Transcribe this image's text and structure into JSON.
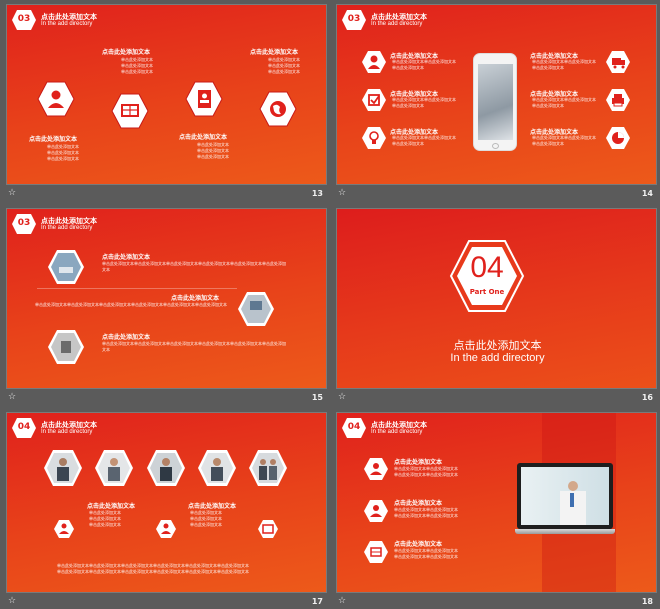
{
  "colors": {
    "accent": "#e0211c",
    "bg": "#5b5b5b",
    "white": "#ffffff"
  },
  "header": {
    "title": "点击此处添加文本",
    "subtitle": "In the add directory"
  },
  "filler": "单击此处添加文本",
  "filler_line": "单击此处添加文本单击此处添加文本",
  "filler_long": "单击此处添加文本单击此处添加文本单击此处添加文本单击此处添加文本单击此处添加文本单击此处添加文本",
  "star": "☆",
  "slides": [
    {
      "number": "13",
      "badge": "03",
      "items": [
        {
          "title": "点击此处添加文本",
          "icon": "user-icon"
        },
        {
          "title": "点击此处添加文本",
          "icon": "globe-network-icon"
        },
        {
          "title": "点击此处添加文本",
          "icon": "contact-book-icon"
        },
        {
          "title": "点击此处添加文本",
          "icon": "world-icon"
        }
      ]
    },
    {
      "number": "14",
      "badge": "03",
      "left": [
        {
          "title": "点击此处添加文本",
          "icon": "user-icon"
        },
        {
          "title": "点击此处添加文本",
          "icon": "checkbox-icon"
        },
        {
          "title": "点击此处添加文本",
          "icon": "lightbulb-icon"
        }
      ],
      "right": [
        {
          "title": "点击此处添加文本",
          "icon": "truck-icon"
        },
        {
          "title": "点击此处添加文本",
          "icon": "printer-icon"
        },
        {
          "title": "点击此处添加文本",
          "icon": "pie-chart-icon"
        }
      ]
    },
    {
      "number": "15",
      "badge": "03",
      "items": [
        {
          "title": "点击此处添加文本"
        },
        {
          "title": "点击此处添加文本"
        },
        {
          "title": "点击此处添加文本"
        }
      ]
    },
    {
      "number": "16",
      "big": "04",
      "part": "Part One",
      "title": "点击此处添加文本",
      "subtitle": "In the add directory"
    },
    {
      "number": "17",
      "badge": "04",
      "items": [
        {
          "title": "点击此处添加文本",
          "icon": "team-icon"
        },
        {
          "title": "点击此处添加文本",
          "icon": "user-icon"
        },
        {
          "title": "点击此处添加文本",
          "icon": "globe-network-icon"
        }
      ]
    },
    {
      "number": "18",
      "badge": "04",
      "items": [
        {
          "title": "点击此处添加文本",
          "icon": "team-icon"
        },
        {
          "title": "点击此处添加文本",
          "icon": "user-icon"
        },
        {
          "title": "点击此处添加文本",
          "icon": "globe-network-icon"
        }
      ]
    }
  ]
}
